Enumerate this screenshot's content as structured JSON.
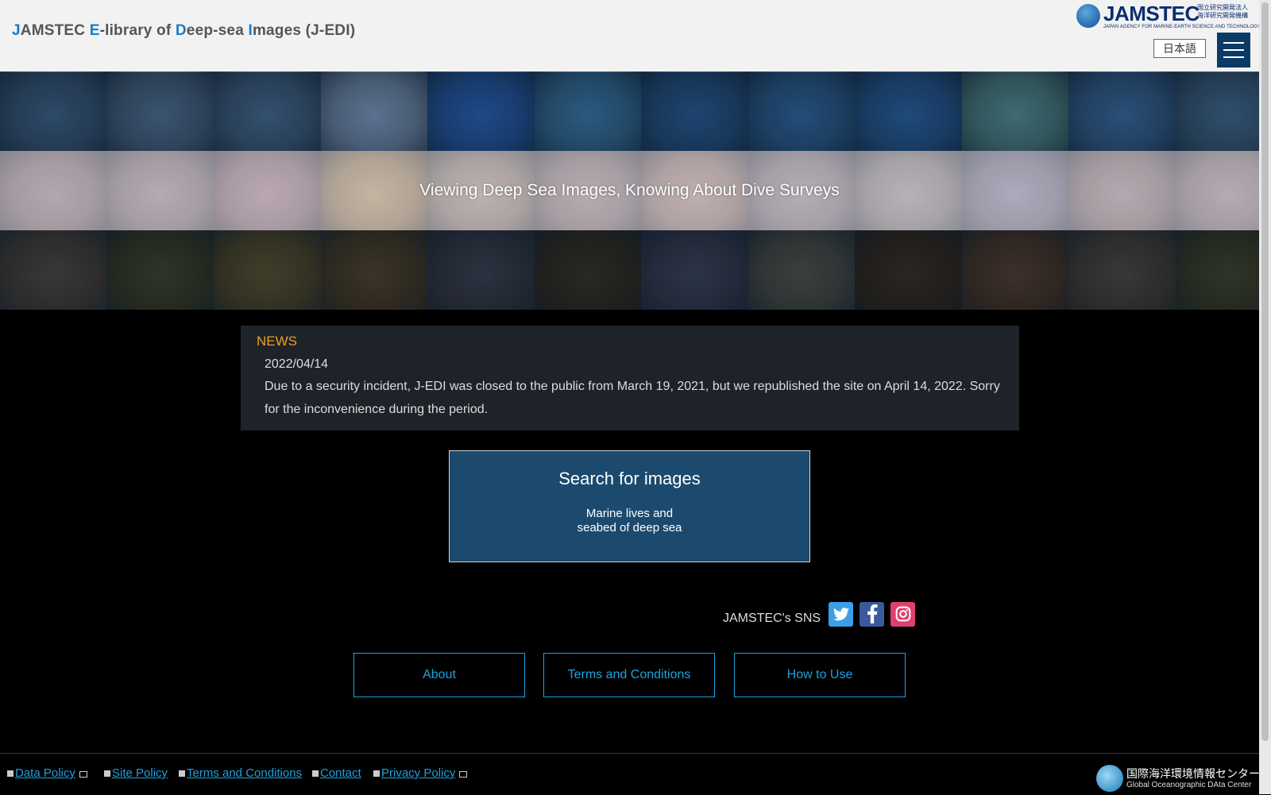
{
  "header": {
    "title_parts": [
      {
        "text": "J",
        "hl": true
      },
      {
        "text": "AMSTEC ",
        "hl": false
      },
      {
        "text": "E",
        "hl": true
      },
      {
        "text": "-library of ",
        "hl": false
      },
      {
        "text": "D",
        "hl": true
      },
      {
        "text": "eep-sea ",
        "hl": false
      },
      {
        "text": "I",
        "hl": true
      },
      {
        "text": "mages (J-EDI)",
        "hl": false
      }
    ],
    "logo_word": "JAMSTEC",
    "logo_jp": "国立研究開発法人 海洋研究開発機構",
    "logo_sub": "JAPAN AGENCY FOR MARINE-EARTH SCIENCE AND TECHNOLOGY",
    "lang_label": "日本語"
  },
  "hero": {
    "tagline": "Viewing Deep Sea Images, Knowing About Dive Surveys",
    "tile_colors": [
      "#2d4a68",
      "#3a5470",
      "#33506e",
      "#5a7290",
      "#1e4a88",
      "#2a5a80",
      "#1e4570",
      "#234d78",
      "#1e4a7a",
      "#3e6a72",
      "#2a4f78",
      "#2f4e6c",
      "#8a7a82",
      "#8c8088",
      "#957a86",
      "#a89068",
      "#9a8c84",
      "#8e8286",
      "#a08a86",
      "#8e8490",
      "#8e8c90",
      "#7c7e98",
      "#8a7c82",
      "#8c8088",
      "#3a3836",
      "#2f3428",
      "#403e2a",
      "#3a3428",
      "#2c3240",
      "#2a2824",
      "#2c3448",
      "#3a4040",
      "#2a2622",
      "#3c302a",
      "#3a3836",
      "#2f3428"
    ]
  },
  "news": {
    "heading": "NEWS",
    "date": "2022/04/14",
    "body": "Due to a security incident, J-EDI was closed to the public from March 19, 2021, but we republished the site on April 14, 2022. Sorry for the inconvenience during the period."
  },
  "search": {
    "title": "Search for images",
    "subtitle": "Marine lives and\nseabed of deep sea"
  },
  "sns": {
    "label": "JAMSTEC's SNS",
    "icons": [
      "twitter-icon",
      "facebook-icon",
      "instagram-icon"
    ]
  },
  "nav": {
    "about": "About",
    "terms": "Terms and Conditions",
    "howto": "How to Use"
  },
  "footer": {
    "links": [
      "Data Policy",
      "Site Policy",
      "Terms and Conditions",
      "Contact",
      "Privacy Policy"
    ],
    "godac_jp": "国際海洋環境情報センター",
    "godac_en": "Global Oceanographic DAta Center"
  },
  "colors": {
    "accent_blue": "#1ba3e0",
    "news_heading": "#f0a020",
    "search_bg": "#1c4a6e",
    "menu_bg": "#0b3a66"
  }
}
